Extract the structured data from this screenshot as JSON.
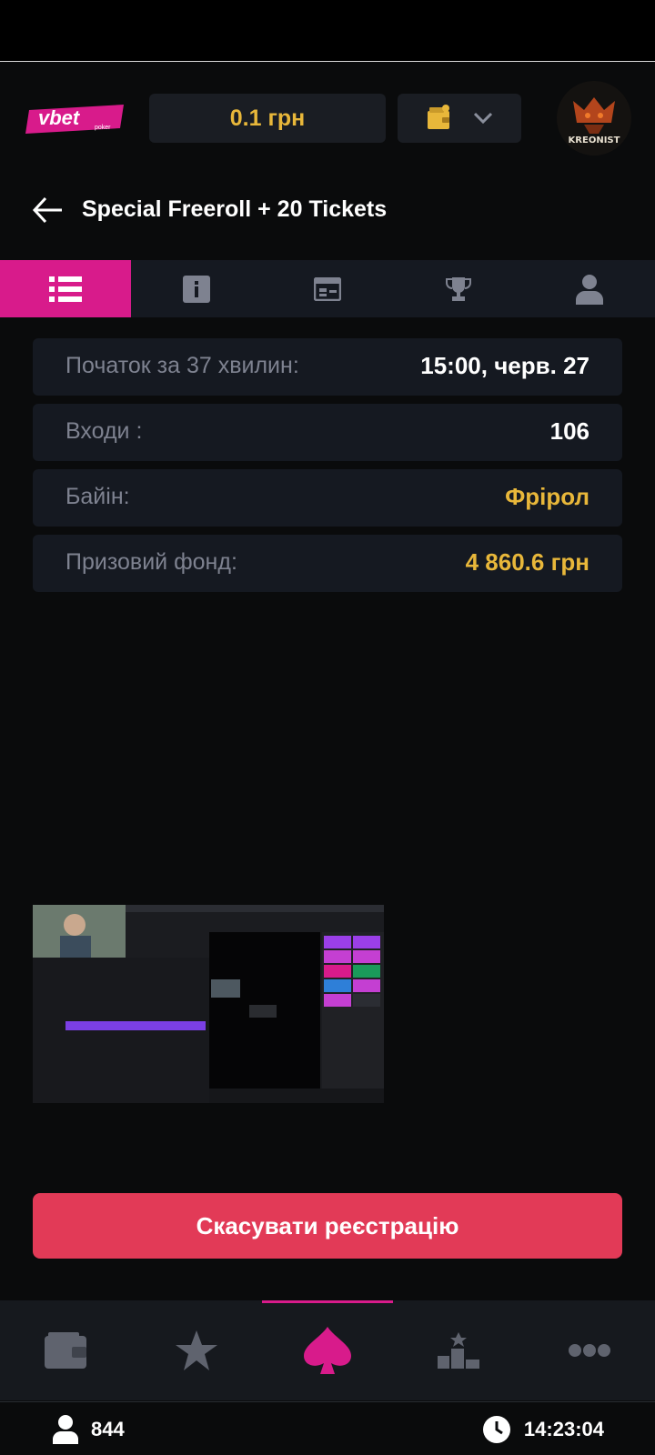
{
  "app": {
    "logo_text": "vbet",
    "logo_sub": "poker",
    "balance": "0.1 грн",
    "avatar_text": "KREONIST"
  },
  "header": {
    "title": "Special Freeroll + 20 Tickets"
  },
  "tabs": [
    {
      "icon": "list-icon",
      "active": true
    },
    {
      "icon": "info-icon",
      "active": false
    },
    {
      "icon": "table-icon",
      "active": false
    },
    {
      "icon": "trophy-icon",
      "active": false
    },
    {
      "icon": "user-icon",
      "active": false
    }
  ],
  "details": [
    {
      "label": "Початок за 37 хвилин:",
      "value": "15:00, черв. 27"
    },
    {
      "label": "Входи :",
      "value": "106"
    },
    {
      "label": "Байін:",
      "value": "Фрірол"
    },
    {
      "label": "Призовий фонд:",
      "value": "4 860.6 грн"
    }
  ],
  "actions": {
    "cancel_label": "Скасувати реєстрацію"
  },
  "bottom_nav": [
    {
      "icon": "wallet-icon"
    },
    {
      "icon": "star-icon"
    },
    {
      "icon": "spade-icon",
      "active": true
    },
    {
      "icon": "podium-icon"
    },
    {
      "icon": "more-icon"
    }
  ],
  "footer": {
    "players_online": "844",
    "time": "14:23:04"
  },
  "colors": {
    "accent": "#d81b8b",
    "gold": "#e8b73a",
    "danger": "#e23a57",
    "panel": "#151921"
  }
}
